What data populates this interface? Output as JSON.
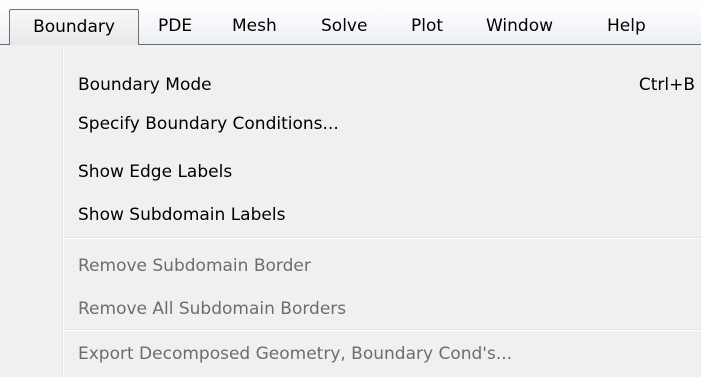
{
  "menubar": {
    "items": [
      {
        "label": "Boundary"
      },
      {
        "label": "PDE"
      },
      {
        "label": "Mesh"
      },
      {
        "label": "Solve"
      },
      {
        "label": "Plot"
      },
      {
        "label": "Window"
      },
      {
        "label": "Help"
      }
    ]
  },
  "dropdown": {
    "items": [
      {
        "label": "Boundary Mode",
        "shortcut": "Ctrl+B",
        "enabled": true
      },
      {
        "label": "Specify Boundary Conditions...",
        "enabled": true
      },
      {
        "label": "Show Edge Labels",
        "enabled": true
      },
      {
        "label": "Show Subdomain Labels",
        "enabled": true
      },
      {
        "label": "Remove Subdomain Border",
        "enabled": false
      },
      {
        "label": "Remove All Subdomain Borders",
        "enabled": false
      },
      {
        "label": "Export Decomposed Geometry, Boundary Cond's...",
        "enabled": false
      }
    ]
  },
  "colors": {
    "enabled_text": "#000000",
    "disabled_text": "#6d6d6d",
    "menu_background": "#f0f0f0"
  }
}
